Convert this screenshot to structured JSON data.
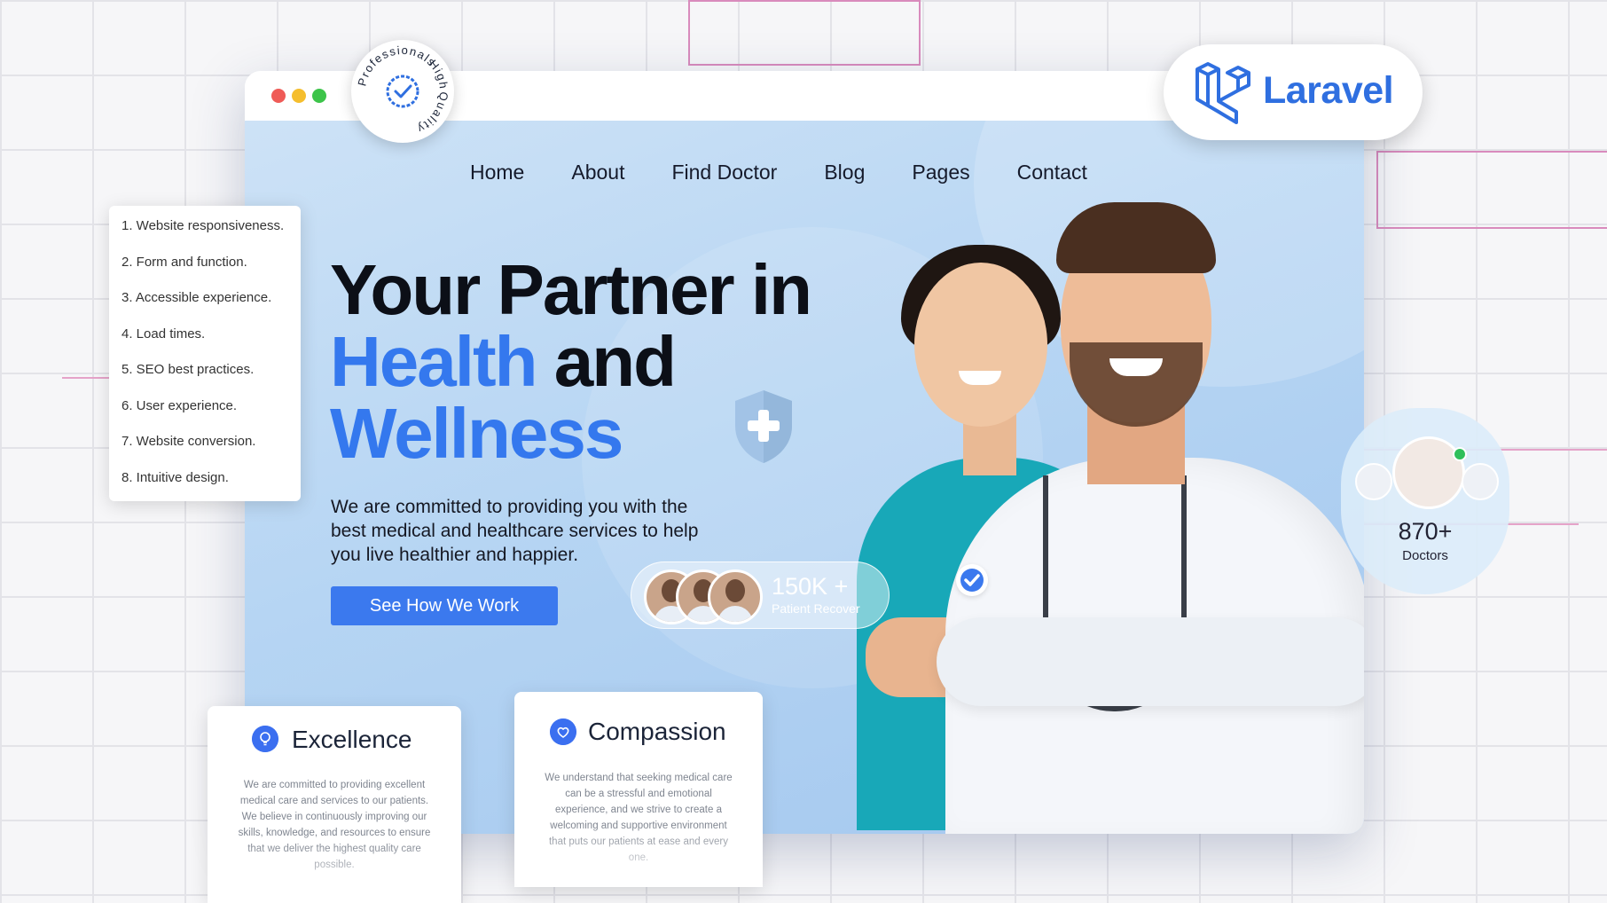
{
  "nav": {
    "items": [
      "Home",
      "About",
      "Find Doctor",
      "Blog",
      "Pages",
      "Contact"
    ]
  },
  "hero": {
    "headline_line1": "Your Partner in",
    "headline_word_health": "Health",
    "headline_word_and": " and",
    "headline_word_wellness": "Wellness",
    "subtext": "We are committed to providing you with the best medical and healthcare services to help you live healthier and happier.",
    "cta_label": "See How We Work"
  },
  "stats": {
    "patients_value": "150K +",
    "patients_label": "Patient Recover",
    "doctors_value": "870+",
    "doctors_label": "Doctors"
  },
  "checklist": [
    "1. Website responsiveness.",
    "2. Form and function.",
    "3. Accessible experience.",
    "4. Load times.",
    "5. SEO best practices.",
    "6. User experience.",
    "7. Website conversion.",
    "8. Intuitive design."
  ],
  "seal": {
    "word1": "Professionals",
    "word2": "High",
    "word3": "Quality"
  },
  "brand": {
    "framework": "Laravel"
  },
  "cards": [
    {
      "title": "Excellence",
      "body": "We are committed to providing excellent medical care and services to our patients. We believe in continuously improving our skills, knowledge, and resources to ensure that we deliver the highest quality care possible."
    },
    {
      "title": "Compassion",
      "body": "We understand that seeking medical care can be a stressful and emotional experience, and we strive to create a welcoming and supportive environment that puts our patients at ease and every one."
    }
  ],
  "colors": {
    "accent": "#3478ee",
    "hero_bg": "#b6d5f3",
    "laravel": "#2f6fe0"
  }
}
